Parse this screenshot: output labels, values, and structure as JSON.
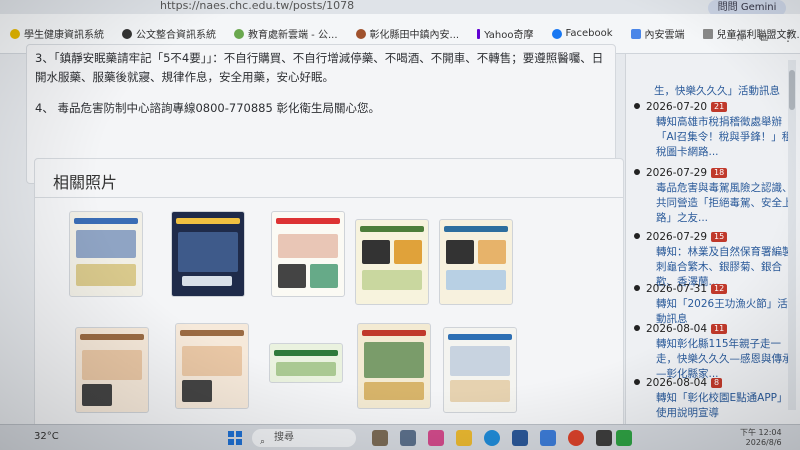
{
  "browser": {
    "url": "https://naes.chc.edu.tw/posts/1078",
    "gemini_label": "問問 Gemini",
    "bookmarks": [
      {
        "label": "學生健康資訊系統",
        "icon": "circle-yellow-icon",
        "color": "#e6b800"
      },
      {
        "label": "公文整合資訊系統",
        "icon": "globe-icon",
        "color": "#333333"
      },
      {
        "label": "教育處新雲端 - 公...",
        "icon": "cloud-icon",
        "color": "#6aa84f"
      },
      {
        "label": "彰化縣田中鎮內安...",
        "icon": "school-icon",
        "color": "#a0522d"
      },
      {
        "label": "Yahoo奇摩",
        "icon": "yahoo-icon",
        "color": "#6001d2"
      },
      {
        "label": "Facebook",
        "icon": "facebook-icon",
        "color": "#1877f2"
      },
      {
        "label": "內安雲端",
        "icon": "drive-icon",
        "color": "#4a86e8"
      },
      {
        "label": "兒童福利聯盟文教...",
        "icon": "page-icon",
        "color": "#888888"
      }
    ]
  },
  "article": {
    "item3": "3、「鎮靜安眠藥請牢記「5不4要」」：不自行購買、不自行增減停藥、不喝酒、不開車、不轉售；要遵照醫囑、日開水服藥、服藥後就寢、規律作息，安全用藥，安心好眠。",
    "item4": "4、 毒品危害防制中心諮詢專線0800-770885 彰化衛生局關心您。"
  },
  "photos": {
    "title": "相關照片"
  },
  "sidebar": {
    "top_link": "生，快樂久久久」活動訊息",
    "entries": [
      {
        "date": "2026-07-20",
        "count": "21",
        "link": "轉知高雄市稅捐稽徵處舉辦「AI召集令！稅與爭鋒！」租稅圖卡網路..."
      },
      {
        "date": "2026-07-29",
        "count": "18",
        "link": "毒品危害與毒駕風險之認識、共同營造「拒絕毒駕、安全上路」之友..."
      },
      {
        "date": "2026-07-29",
        "count": "15",
        "link": "轉知：林業及自然保育署編製刺龜合繁木、銀膠菊、銀合歡、香澤蘭..."
      },
      {
        "date": "2026-07-31",
        "count": "12",
        "link": "轉知「2026王功漁火節」活動訊息"
      },
      {
        "date": "2026-08-04",
        "count": "11",
        "link": "轉知彰化縣115年親子走一走，快樂久久久—感恩與傳承—彰化縣家..."
      },
      {
        "date": "2026-08-04",
        "count": "8",
        "link": "轉知「彰化校園E點通APP」使用說明宣導"
      }
    ]
  },
  "taskbar": {
    "weather": "32°C",
    "search_placeholder": "搜尋",
    "time": "下午 12:04",
    "date": "2026/8/6"
  }
}
